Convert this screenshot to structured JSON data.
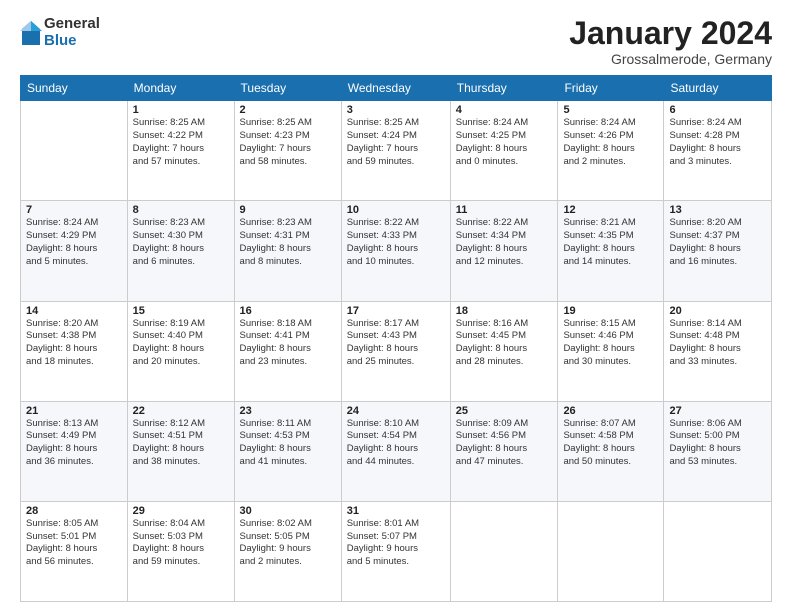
{
  "logo": {
    "general": "General",
    "blue": "Blue"
  },
  "header": {
    "month": "January 2024",
    "location": "Grossalmerode, Germany"
  },
  "days_of_week": [
    "Sunday",
    "Monday",
    "Tuesday",
    "Wednesday",
    "Thursday",
    "Friday",
    "Saturday"
  ],
  "weeks": [
    [
      {
        "day": "",
        "info": ""
      },
      {
        "day": "1",
        "info": "Sunrise: 8:25 AM\nSunset: 4:22 PM\nDaylight: 7 hours\nand 57 minutes."
      },
      {
        "day": "2",
        "info": "Sunrise: 8:25 AM\nSunset: 4:23 PM\nDaylight: 7 hours\nand 58 minutes."
      },
      {
        "day": "3",
        "info": "Sunrise: 8:25 AM\nSunset: 4:24 PM\nDaylight: 7 hours\nand 59 minutes."
      },
      {
        "day": "4",
        "info": "Sunrise: 8:24 AM\nSunset: 4:25 PM\nDaylight: 8 hours\nand 0 minutes."
      },
      {
        "day": "5",
        "info": "Sunrise: 8:24 AM\nSunset: 4:26 PM\nDaylight: 8 hours\nand 2 minutes."
      },
      {
        "day": "6",
        "info": "Sunrise: 8:24 AM\nSunset: 4:28 PM\nDaylight: 8 hours\nand 3 minutes."
      }
    ],
    [
      {
        "day": "7",
        "info": "Sunrise: 8:24 AM\nSunset: 4:29 PM\nDaylight: 8 hours\nand 5 minutes."
      },
      {
        "day": "8",
        "info": "Sunrise: 8:23 AM\nSunset: 4:30 PM\nDaylight: 8 hours\nand 6 minutes."
      },
      {
        "day": "9",
        "info": "Sunrise: 8:23 AM\nSunset: 4:31 PM\nDaylight: 8 hours\nand 8 minutes."
      },
      {
        "day": "10",
        "info": "Sunrise: 8:22 AM\nSunset: 4:33 PM\nDaylight: 8 hours\nand 10 minutes."
      },
      {
        "day": "11",
        "info": "Sunrise: 8:22 AM\nSunset: 4:34 PM\nDaylight: 8 hours\nand 12 minutes."
      },
      {
        "day": "12",
        "info": "Sunrise: 8:21 AM\nSunset: 4:35 PM\nDaylight: 8 hours\nand 14 minutes."
      },
      {
        "day": "13",
        "info": "Sunrise: 8:20 AM\nSunset: 4:37 PM\nDaylight: 8 hours\nand 16 minutes."
      }
    ],
    [
      {
        "day": "14",
        "info": "Sunrise: 8:20 AM\nSunset: 4:38 PM\nDaylight: 8 hours\nand 18 minutes."
      },
      {
        "day": "15",
        "info": "Sunrise: 8:19 AM\nSunset: 4:40 PM\nDaylight: 8 hours\nand 20 minutes."
      },
      {
        "day": "16",
        "info": "Sunrise: 8:18 AM\nSunset: 4:41 PM\nDaylight: 8 hours\nand 23 minutes."
      },
      {
        "day": "17",
        "info": "Sunrise: 8:17 AM\nSunset: 4:43 PM\nDaylight: 8 hours\nand 25 minutes."
      },
      {
        "day": "18",
        "info": "Sunrise: 8:16 AM\nSunset: 4:45 PM\nDaylight: 8 hours\nand 28 minutes."
      },
      {
        "day": "19",
        "info": "Sunrise: 8:15 AM\nSunset: 4:46 PM\nDaylight: 8 hours\nand 30 minutes."
      },
      {
        "day": "20",
        "info": "Sunrise: 8:14 AM\nSunset: 4:48 PM\nDaylight: 8 hours\nand 33 minutes."
      }
    ],
    [
      {
        "day": "21",
        "info": "Sunrise: 8:13 AM\nSunset: 4:49 PM\nDaylight: 8 hours\nand 36 minutes."
      },
      {
        "day": "22",
        "info": "Sunrise: 8:12 AM\nSunset: 4:51 PM\nDaylight: 8 hours\nand 38 minutes."
      },
      {
        "day": "23",
        "info": "Sunrise: 8:11 AM\nSunset: 4:53 PM\nDaylight: 8 hours\nand 41 minutes."
      },
      {
        "day": "24",
        "info": "Sunrise: 8:10 AM\nSunset: 4:54 PM\nDaylight: 8 hours\nand 44 minutes."
      },
      {
        "day": "25",
        "info": "Sunrise: 8:09 AM\nSunset: 4:56 PM\nDaylight: 8 hours\nand 47 minutes."
      },
      {
        "day": "26",
        "info": "Sunrise: 8:07 AM\nSunset: 4:58 PM\nDaylight: 8 hours\nand 50 minutes."
      },
      {
        "day": "27",
        "info": "Sunrise: 8:06 AM\nSunset: 5:00 PM\nDaylight: 8 hours\nand 53 minutes."
      }
    ],
    [
      {
        "day": "28",
        "info": "Sunrise: 8:05 AM\nSunset: 5:01 PM\nDaylight: 8 hours\nand 56 minutes."
      },
      {
        "day": "29",
        "info": "Sunrise: 8:04 AM\nSunset: 5:03 PM\nDaylight: 8 hours\nand 59 minutes."
      },
      {
        "day": "30",
        "info": "Sunrise: 8:02 AM\nSunset: 5:05 PM\nDaylight: 9 hours\nand 2 minutes."
      },
      {
        "day": "31",
        "info": "Sunrise: 8:01 AM\nSunset: 5:07 PM\nDaylight: 9 hours\nand 5 minutes."
      },
      {
        "day": "",
        "info": ""
      },
      {
        "day": "",
        "info": ""
      },
      {
        "day": "",
        "info": ""
      }
    ]
  ]
}
